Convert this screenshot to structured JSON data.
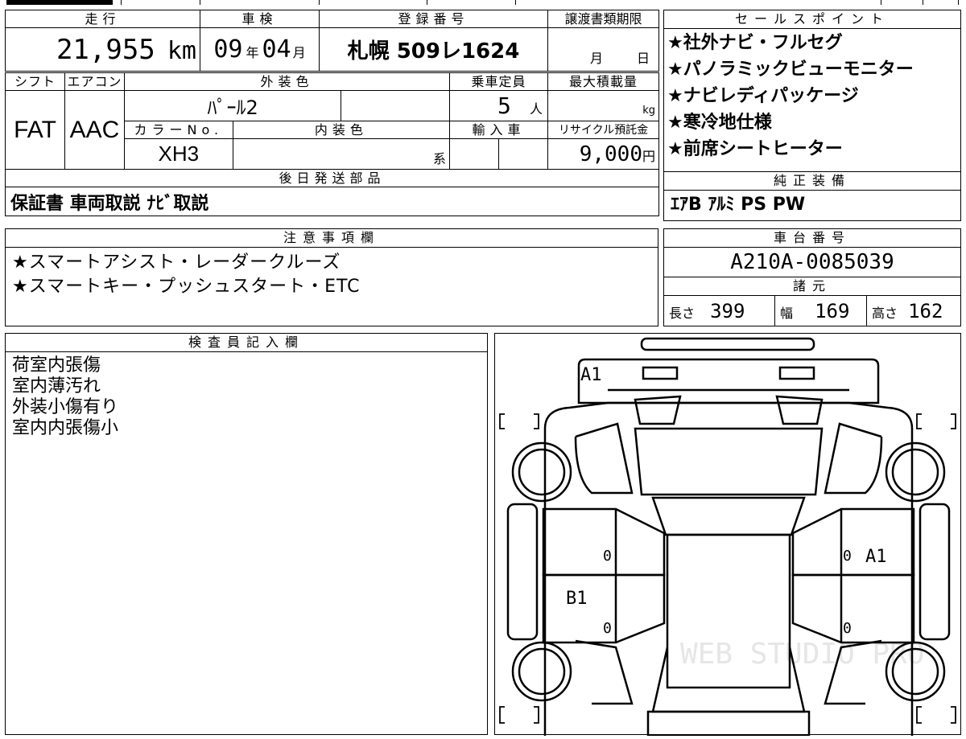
{
  "header": {
    "mileage_label": "走行",
    "inspection_label": "車検",
    "registration_label": "登録番号",
    "transfer_label": "譲渡書類期限",
    "mileage_value": "21,955",
    "mileage_unit": "km",
    "inspection_year": "09",
    "year_unit": "年",
    "inspection_month": "04",
    "month_unit": "月",
    "registration_value": "札幌 509レ1624",
    "transfer_month_unit": "月",
    "transfer_day_unit": "日"
  },
  "specs": {
    "shift_label": "シフト",
    "aircon_label": "エアコン",
    "exterior_color_label": "外装色",
    "capacity_label": "乗車定員",
    "max_load_label": "最大積載量",
    "shift_value": "FAT",
    "aircon_value": "AAC",
    "exterior_color_value": "ﾊﾟｰﾙ2",
    "capacity_value": "5",
    "capacity_unit": "人",
    "max_load_unit": "kg",
    "color_no_label": "カラーNo.",
    "interior_color_label": "内装色",
    "import_label": "輸入車",
    "recycle_label": "リサイクル預託金",
    "color_no_value": "XH3",
    "interior_suffix": "系",
    "recycle_value": "9,000",
    "recycle_unit": "円"
  },
  "later_parts": {
    "label": "後日発送部品",
    "value": "保証書 車両取説 ﾅﾋﾞ取説"
  },
  "sales_points": {
    "label": "セールスポイント",
    "items": [
      "★社外ナビ・フルセグ",
      "★パノラミックビューモニター",
      "★ナビレディパッケージ",
      "★寒冷地仕様",
      "★前席シートヒーター"
    ]
  },
  "genuine_equipment": {
    "label": "純正装備",
    "value": "ｴｱB ｱﾙﾐ PS PW"
  },
  "notes": {
    "label": "注意事項欄",
    "items": [
      "★スマートアシスト・レーダークルーズ",
      "★スマートキー・プッシュスタート・ETC"
    ]
  },
  "chassis": {
    "label": "車台番号",
    "value": "A210A-0085039"
  },
  "dimensions": {
    "label": "諸元",
    "length_label": "長さ",
    "length_value": "399",
    "width_label": "幅",
    "width_value": "169",
    "height_label": "高さ",
    "height_value": "162"
  },
  "inspector": {
    "label": "検査員記入欄",
    "items": [
      "荷室内張傷",
      "室内薄汚れ",
      "外装小傷有り",
      "室内内張傷小"
    ]
  },
  "diagram": {
    "mark_rear": "A1",
    "mark_right_door": "A1",
    "mark_left_door": "B1",
    "zero": "0",
    "watermark": "WEB STUDIO PRO"
  }
}
